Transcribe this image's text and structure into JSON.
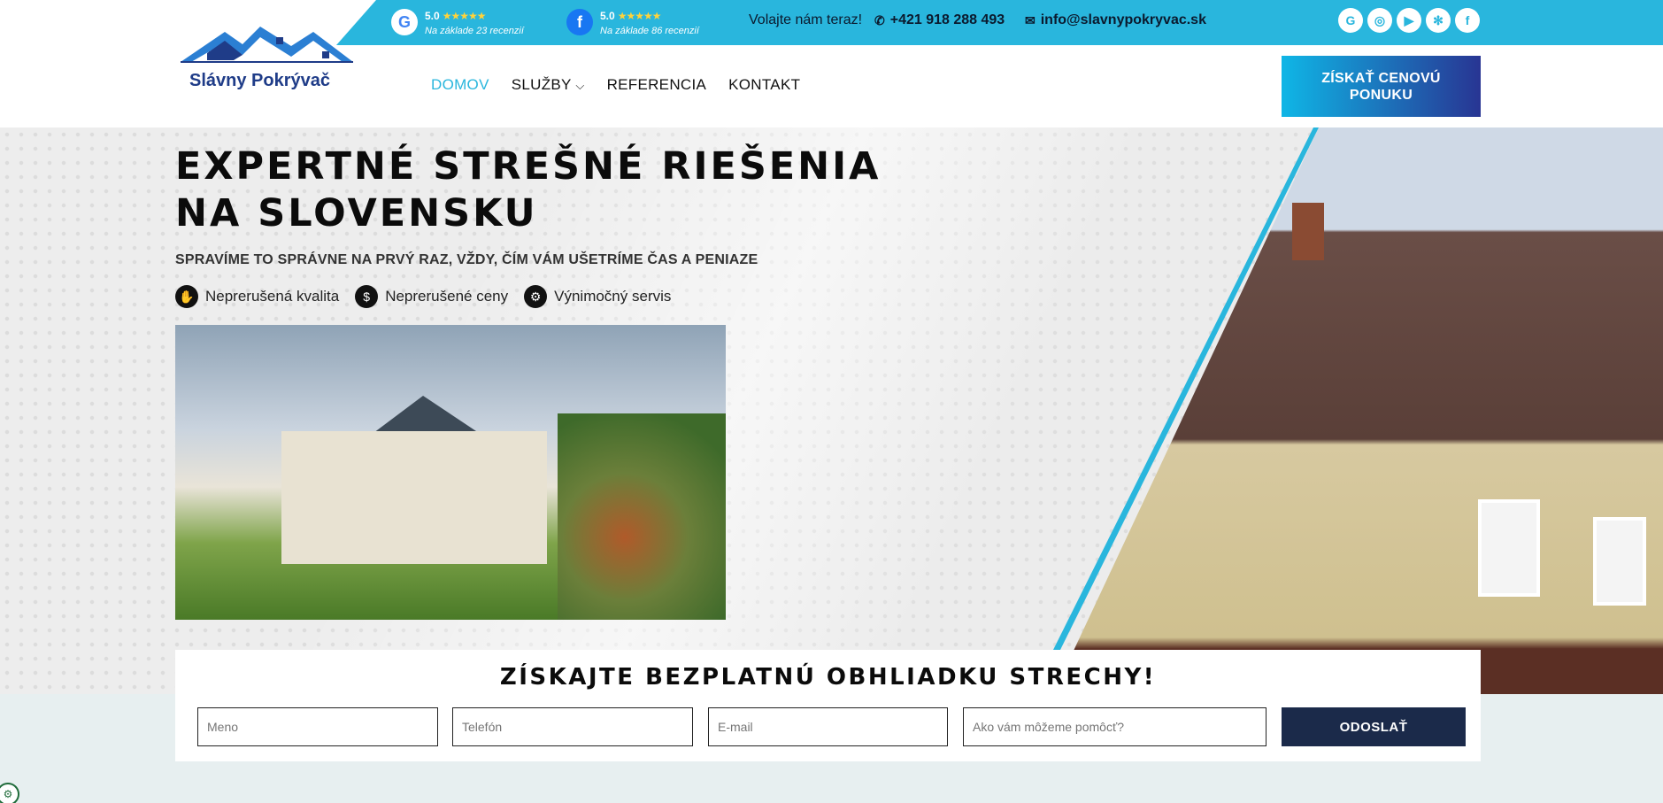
{
  "topbar": {
    "google": {
      "score": "5.0",
      "stars": "★★★★★",
      "basis": "Na základe 23 recenzií"
    },
    "facebook": {
      "score": "5.0",
      "stars": "★★★★★",
      "basis": "Na základe 86 recenzií"
    },
    "call_label": "Volajte nám teraz!",
    "phone": "+421 918 288 493",
    "email": "info@slavnypokryvac.sk",
    "socials": [
      "google-icon",
      "instagram-icon",
      "youtube-icon",
      "yelp-icon",
      "facebook-icon"
    ]
  },
  "logo": {
    "name": "Slávny Pokrývač"
  },
  "nav": {
    "items": [
      "DOMOV",
      "SLUŽBY",
      "REFERENCIA",
      "KONTAKT"
    ],
    "active": "DOMOV",
    "cta": "ZÍSKAŤ CENOVÚ PONUKU"
  },
  "hero": {
    "title_line1": "EXPERTNÉ STREŠNÉ RIEŠENIA",
    "title_line2": "NA SLOVENSKU",
    "subtitle": "SPRAVÍME TO SPRÁVNE NA PRVÝ RAZ, VŽDY, ČÍM VÁM UŠETRÍME ČAS A PENIAZE",
    "features": [
      "Neprerušená kvalita",
      "Neprerušené ceny",
      "Výnimočný servis"
    ]
  },
  "form": {
    "title": "ZÍSKAJTE BEZPLATNÚ OBHLIADKU STRECHY!",
    "name_placeholder": "Meno",
    "phone_placeholder": "Telefón",
    "email_placeholder": "E-mail",
    "help_placeholder": "Ako vám môžeme pomôcť?",
    "submit": "ODOSLAŤ"
  },
  "colors": {
    "accent": "#29b6dd",
    "navy": "#1b2a4a",
    "cta_start": "#0fb6e6",
    "cta_end": "#283593"
  }
}
